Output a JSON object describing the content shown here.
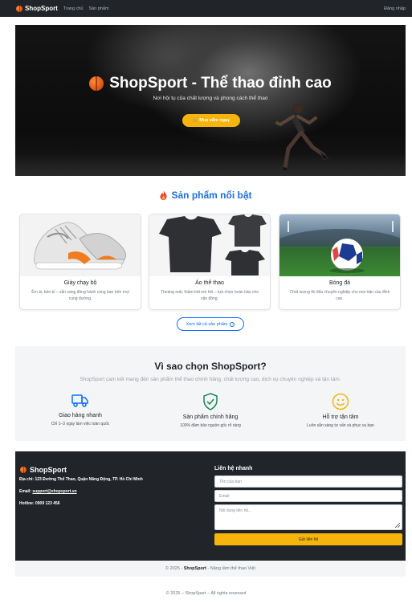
{
  "navbar": {
    "brand": "ShopSport",
    "links": [
      "Trang chủ",
      "Sản phẩm"
    ],
    "login": "Đăng nhập"
  },
  "hero": {
    "title": "ShopSport - Thể thao đỉnh cao",
    "subtitle": "Nơi hội tụ của chất lượng và phong cách thể thao",
    "button": "🛒 Mua sắm ngay"
  },
  "featured": {
    "title": "Sản phẩm nổi bật",
    "products": [
      {
        "name": "Giày chạy bộ",
        "desc": "Êm ái, bền bỉ – sẵn sàng đồng hành cùng bạn trên mọi cung đường."
      },
      {
        "name": "Áo thể thao",
        "desc": "Thoáng mát, thấm hút mồ hôi – lựa chọn hoàn hảo cho vận động."
      },
      {
        "name": "Bóng đá",
        "desc": "Chất lượng thi đấu chuyên nghiệp cho mọi trận cầu đỉnh cao."
      }
    ],
    "view_all": "Xem tất cả sản phẩm"
  },
  "why": {
    "title": "Vì sao chọn ShopSport?",
    "subtitle": "ShopSport cam kết mang đến sản phẩm thể thao chính hãng, chất lượng cao, dịch vụ chuyên nghiệp và tận tâm.",
    "features": [
      {
        "title": "Giao hàng nhanh",
        "desc": "Chỉ 1–3 ngày làm việc toàn quốc",
        "icon": "truck-icon",
        "color": "#0d6efd"
      },
      {
        "title": "Sản phẩm chính hãng",
        "desc": "100% đảm bảo nguồn gốc rõ ràng",
        "icon": "shield-check-icon",
        "color": "#198754"
      },
      {
        "title": "Hỗ trợ tận tâm",
        "desc": "Luôn sẵn sàng tư vấn và phục vụ bạn",
        "icon": "smile-icon",
        "color": "#f5b50a"
      }
    ]
  },
  "footer": {
    "brand": "ShopSport",
    "address_label": "Địa chỉ:",
    "address": "123 Đường Thể Thao, Quận Năng Động, TP. Hồ Chí Minh",
    "email_label": "Email:",
    "email": "support@shopsport.vn",
    "hotline_label": "Hotline:",
    "hotline": "0909 123 456",
    "contact_title": "Liên hệ nhanh",
    "name_placeholder": "Tên của bạn",
    "email_placeholder": "Email",
    "message_placeholder": "Nội dung liên hệ...",
    "send": "Gửi liên hệ"
  },
  "subfooter": {
    "prefix": "© 2025 -",
    "brand": "ShopSport",
    "suffix": "- Nâng tầm thể thao Việt"
  },
  "copyright": "© 2025 – ShopSport – All rights reserved",
  "colors": {
    "navbar": "#212529",
    "accent_blue": "#1d6fd8",
    "accent_yellow": "#f5b50a",
    "footer": "#212529"
  }
}
